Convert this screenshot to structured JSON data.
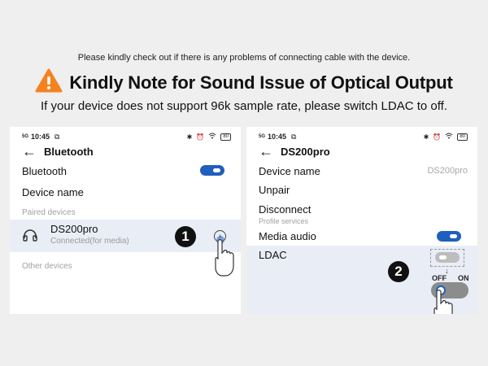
{
  "banner": {
    "intro": "Please kindly check out if there is any problems of connecting cable with the device.",
    "title": "Kindly Note for Sound Issue of Optical Output",
    "subtitle": "If your device does not support 96k sample rate, please switch LDAC to off.",
    "warning_color": "#f58220",
    "warning_icon": "warning-triangle-icon"
  },
  "left_screen": {
    "status": {
      "signal": "5G",
      "time": "10:45",
      "battery": "80"
    },
    "header_title": "Bluetooth",
    "bluetooth_label": "Bluetooth",
    "bluetooth_on": true,
    "device_name_label": "Device name",
    "paired_section": "Paired devices",
    "device": {
      "name": "DS200pro",
      "status": "Connected(for media)",
      "icon": "headphones-icon"
    },
    "other_section": "Other devices",
    "step_badge": "1"
  },
  "right_screen": {
    "status": {
      "signal": "5G",
      "time": "10:45",
      "battery": "80"
    },
    "header_title": "DS200pro",
    "device_name_label": "Device name",
    "device_name_value": "DS200pro",
    "unpair_label": "Unpair",
    "disconnect_label": "Disconnect",
    "profile_section": "Profile services",
    "media_audio_label": "Media audio",
    "media_audio_on": true,
    "ldac_label": "LDAC",
    "ldac_on": false,
    "off_label": "OFF",
    "on_label": "ON",
    "step_badge": "2"
  },
  "colors": {
    "toggle_on": "#1f5fbd",
    "toggle_off": "#bdbdbd",
    "highlight_row": "#e9edf6"
  }
}
